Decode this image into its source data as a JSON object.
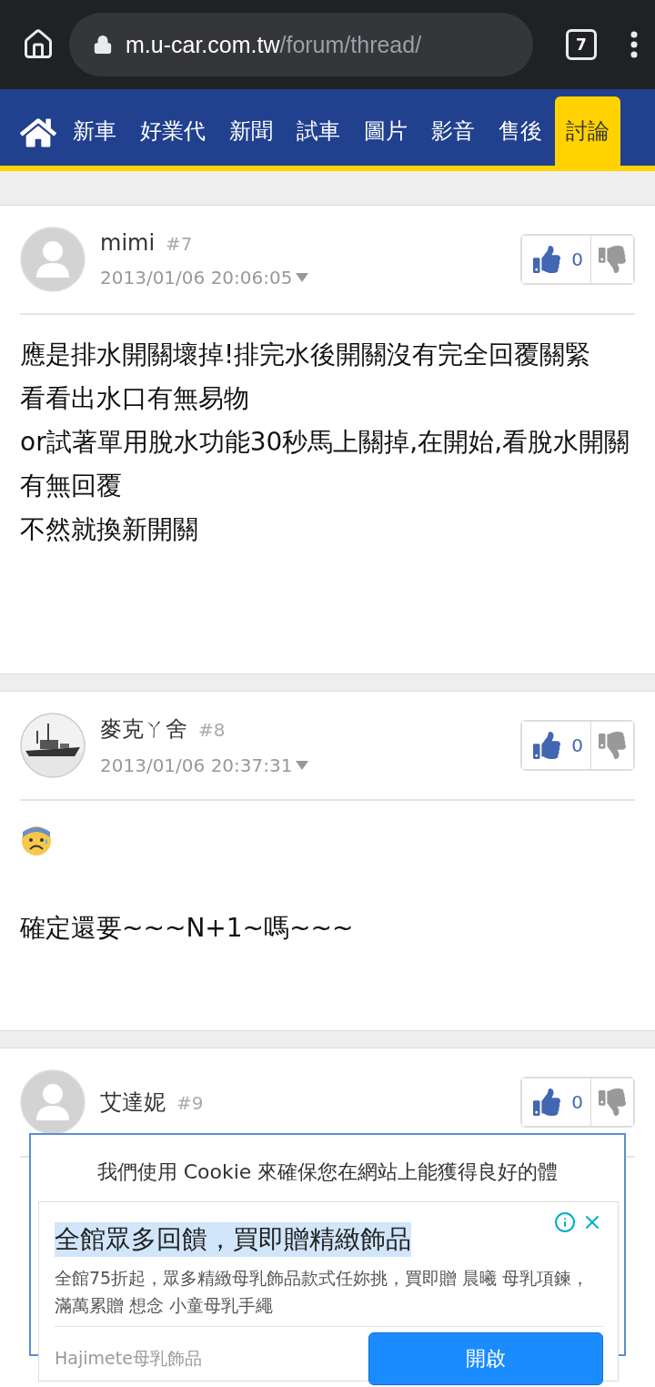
{
  "browser": {
    "url_host": "m.u-car.com.tw",
    "url_path": "/forum/thread/",
    "tab_count": "7"
  },
  "nav": {
    "items": [
      {
        "label": "新車",
        "selected": false
      },
      {
        "label": "好業代",
        "selected": false
      },
      {
        "label": "新聞",
        "selected": false
      },
      {
        "label": "試車",
        "selected": false
      },
      {
        "label": "圖片",
        "selected": false
      },
      {
        "label": "影音",
        "selected": false
      },
      {
        "label": "售後",
        "selected": false
      },
      {
        "label": "討論",
        "selected": true
      }
    ]
  },
  "posts": [
    {
      "author": "mimi",
      "floor": "#7",
      "time": "2013/01/06 20:06:05",
      "avatar": {
        "kind": "default"
      },
      "likes": "0",
      "content": [
        {
          "kind": "text",
          "text": "應是排水開關壞掉!排完水後開關沒有完全回覆關緊"
        },
        {
          "kind": "text",
          "text": "看看出水口有無易物"
        },
        {
          "kind": "text",
          "text": "or試著單用脫水功能30秒馬上關掉,在開始,看脫水開關有無回覆"
        },
        {
          "kind": "text",
          "text": "不然就換新開關"
        }
      ]
    },
    {
      "author": "麥克ㄚ舍",
      "floor": "#8",
      "time": "2013/01/06 20:37:31",
      "avatar": {
        "kind": "picture"
      },
      "likes": "0",
      "content": [
        {
          "kind": "emoji"
        },
        {
          "kind": "blank"
        },
        {
          "kind": "text",
          "text": "確定還要~~~N+1~嗎~~~"
        }
      ]
    },
    {
      "author": "艾達妮",
      "floor": "#9",
      "avatar": {
        "kind": "default"
      },
      "likes": "0"
    }
  ],
  "cookie_notice": {
    "text": "我們使用 Cookie 來確保您在網站上能獲得良好的體"
  },
  "ad": {
    "title": "全館眾多回饋，買即贈精緻飾品",
    "body": "全館75折起，眾多精緻母乳飾品款式任妳挑，買即贈 晨曦 母乳項鍊，滿萬累贈 想念 小童母乳手繩",
    "advertiser": "Hajimete母乳飾品",
    "button": "開啟"
  }
}
